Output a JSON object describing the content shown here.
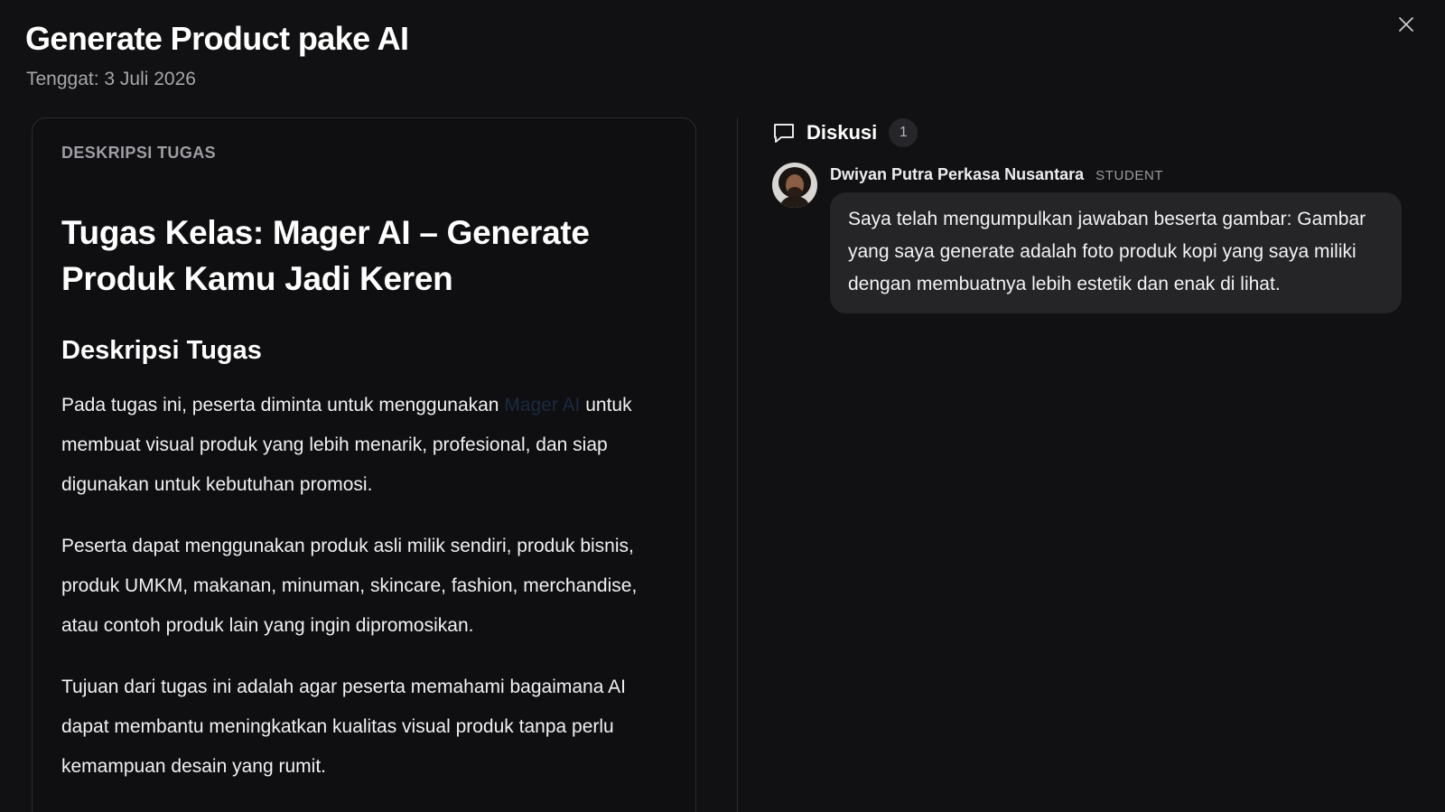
{
  "modal": {
    "title": "Generate Product pake AI",
    "due": "Tenggat: 3 Juli 2026"
  },
  "task": {
    "section_label": "DESKRIPSI TUGAS",
    "heading": "Tugas Kelas: Mager AI – Generate Produk Kamu Jadi Keren",
    "subheading": "Deskripsi Tugas",
    "p1_before_link": "Pada tugas ini, peserta diminta untuk menggunakan ",
    "p1_link": "Mager AI",
    "p1_after_link": " untuk membuat visual produk yang lebih menarik, profesional, dan siap digunakan untuk kebutuhan promosi.",
    "p2": "Peserta dapat menggunakan produk asli milik sendiri, produk bisnis, produk UMKM, makanan, minuman, skincare, fashion, merchandise, atau contoh produk lain yang ingin dipromosikan.",
    "p3": "Tujuan dari tugas ini adalah agar peserta memahami bagaimana AI dapat membantu meningkatkan kualitas visual produk tanpa perlu kemampuan desain yang rumit."
  },
  "discussion": {
    "title": "Diskusi",
    "count": "1",
    "comments": [
      {
        "author": "Dwiyan Putra Perkasa Nusantara",
        "role": "STUDENT",
        "text": "Saya telah mengumpulkan jawaban beserta gambar: Gambar yang saya generate adalah foto produk kopi yang saya miliki dengan membuatnya lebih estetik dan enak di lihat."
      }
    ]
  },
  "icons": {
    "close": "close-icon",
    "discussion": "chat-bubble-icon"
  }
}
